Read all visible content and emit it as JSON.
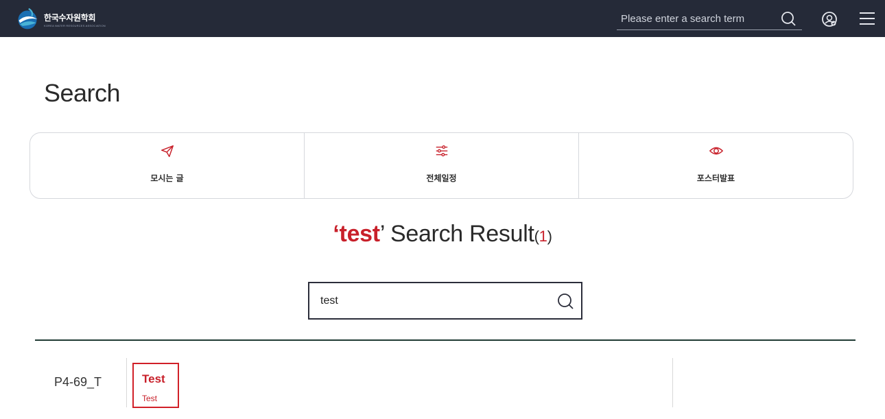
{
  "header": {
    "logo_name": "한국수자원학회",
    "logo_sub": "KOREA WATER RESOURCES ASSOCIATION",
    "search_placeholder": "Please enter a search term",
    "icons": {
      "search": "search-icon",
      "user": "user-icon",
      "menu": "hamburger-menu-icon"
    },
    "bg_color": "#252a38"
  },
  "page": {
    "title": "Search"
  },
  "quick_nav": [
    {
      "label": "모시는 글",
      "icon": "paper-plane-icon"
    },
    {
      "label": "전체일정",
      "icon": "sliders-icon"
    },
    {
      "label": "포스터발표",
      "icon": "eye-icon"
    }
  ],
  "result_heading": {
    "open_quote": "‘",
    "keyword": "test",
    "close_quote": "’",
    "text": " Search Result",
    "count_open": "(",
    "count": "1",
    "count_close": ")"
  },
  "search": {
    "value": "test"
  },
  "results": [
    {
      "code": "P4-69_T",
      "title": "Test",
      "subtitle": "Test"
    }
  ],
  "colors": {
    "accent": "#c8202a",
    "divider": "#1f3a33",
    "border": "#2b2d3a"
  }
}
